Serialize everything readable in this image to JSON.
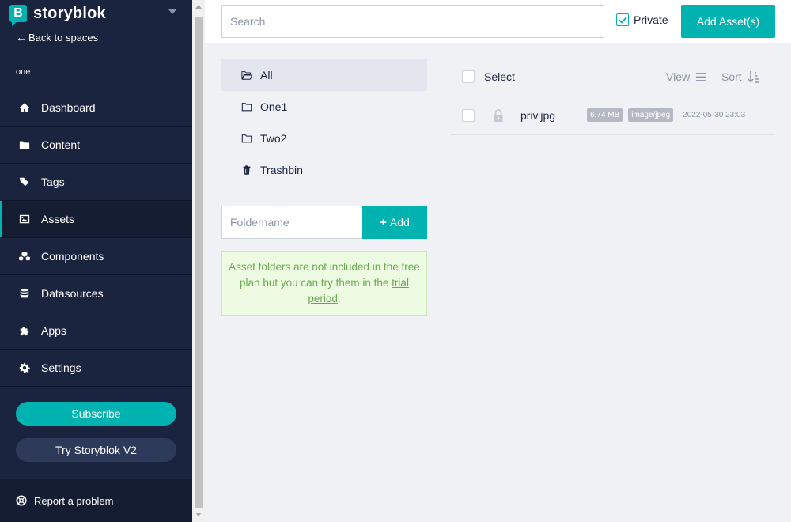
{
  "brand": {
    "logo_letter": "B",
    "name": "storyblok"
  },
  "sidebar": {
    "back_label": "Back to spaces",
    "space_name": "one",
    "items": [
      {
        "label": "Dashboard",
        "icon": "home-icon"
      },
      {
        "label": "Content",
        "icon": "folder-icon"
      },
      {
        "label": "Tags",
        "icon": "tags-icon"
      },
      {
        "label": "Assets",
        "icon": "image-icon",
        "active": true
      },
      {
        "label": "Components",
        "icon": "cubes-icon"
      },
      {
        "label": "Datasources",
        "icon": "database-icon"
      },
      {
        "label": "Apps",
        "icon": "puzzle-icon"
      },
      {
        "label": "Settings",
        "icon": "gear-icon"
      }
    ],
    "subscribe_label": "Subscribe",
    "try_label": "Try Storyblok V2",
    "report_label": "Report a problem"
  },
  "header": {
    "search_placeholder": "Search",
    "private_label": "Private",
    "private_checked": true,
    "add_asset_label": "Add Asset(s)"
  },
  "folders": {
    "items": [
      {
        "label": "All",
        "icon": "folder-open-icon",
        "active": true
      },
      {
        "label": "One1",
        "icon": "folder-icon"
      },
      {
        "label": "Two2",
        "icon": "folder-icon"
      },
      {
        "label": "Trashbin",
        "icon": "trash-icon"
      }
    ],
    "input_placeholder": "Foldername",
    "add_label": "Add",
    "notice_text": "Asset folders are not included in the free plan but you can try them in the",
    "notice_link": "trial period",
    "notice_end": "."
  },
  "list": {
    "select_label": "Select",
    "view_label": "View",
    "sort_label": "Sort",
    "assets": [
      {
        "name": "priv.jpg",
        "size": "6.74 MB",
        "type": "image/jpeg",
        "date": "2022-05-30 23:03",
        "private": true
      }
    ]
  },
  "colors": {
    "accent": "#00b3b0",
    "sidebar_bg": "#1b243f",
    "notice_bg": "#eefbe3",
    "notice_text": "#6aa84f"
  }
}
